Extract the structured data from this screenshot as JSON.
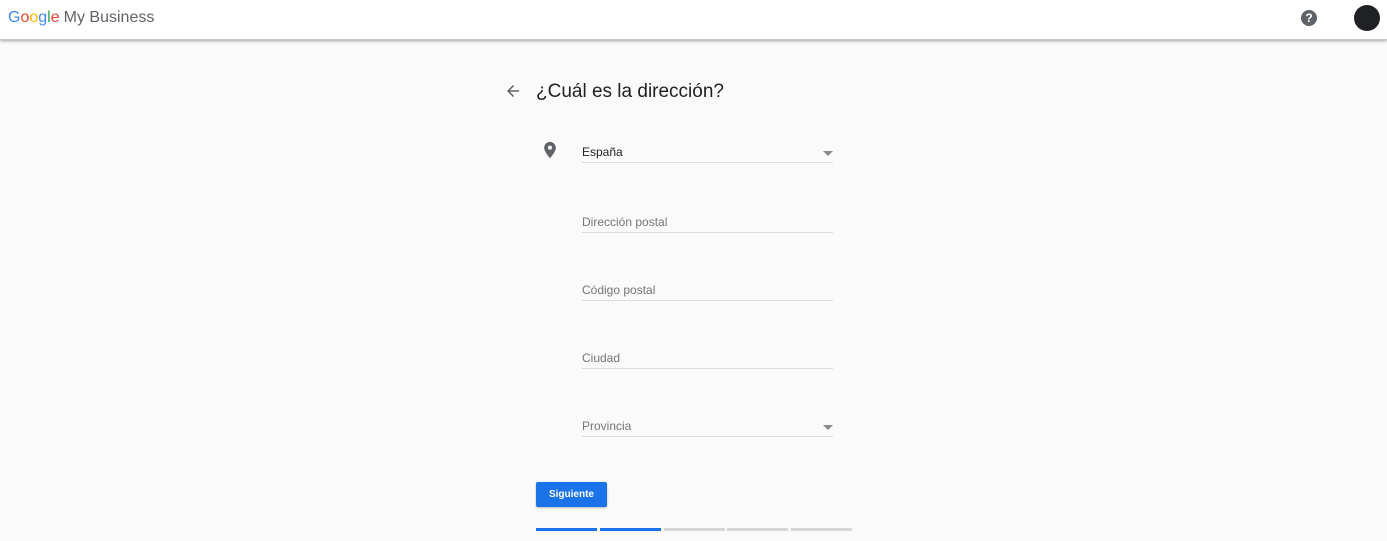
{
  "header": {
    "logo_google": [
      "G",
      "o",
      "o",
      "g",
      "l",
      "e"
    ],
    "logo_product": "My Business",
    "help_icon": "help-circle-icon",
    "avatar": "account-avatar"
  },
  "page": {
    "title": "¿Cuál es la dirección?",
    "back_icon": "arrow-back-icon",
    "location_icon": "location-pin-icon"
  },
  "form": {
    "country": {
      "value": "España",
      "icon": "dropdown-arrow-icon"
    },
    "street": {
      "placeholder": "Dirección postal",
      "value": ""
    },
    "postal_code": {
      "placeholder": "Código postal",
      "value": ""
    },
    "city": {
      "placeholder": "Ciudad",
      "value": ""
    },
    "province": {
      "placeholder": "Provincia",
      "icon": "dropdown-arrow-icon"
    }
  },
  "actions": {
    "next_label": "Siguiente"
  },
  "progress": {
    "steps_total": 5,
    "steps_completed": 2
  },
  "colors": {
    "accent": "#1a73e8",
    "progress_inactive": "#d6d6d6",
    "background": "#fafafa"
  }
}
